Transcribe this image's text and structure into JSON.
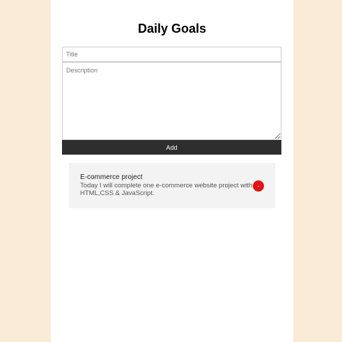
{
  "header": {
    "title": "Daily Goals"
  },
  "form": {
    "title_placeholder": "Title",
    "title_value": "",
    "description_placeholder": "Description",
    "description_value": "",
    "add_label": "Add"
  },
  "goals": [
    {
      "title": "E-commerce project",
      "description": "Today I will complete one e-commerce website project with HTML,CSS & JavaScript.",
      "delete_label": "-"
    }
  ],
  "colors": {
    "page_background": "#faebd7",
    "panel_background": "#ffffff",
    "button_background": "#2e2e2e",
    "card_background": "#f3f3f3",
    "delete_accent": "#e31313"
  }
}
